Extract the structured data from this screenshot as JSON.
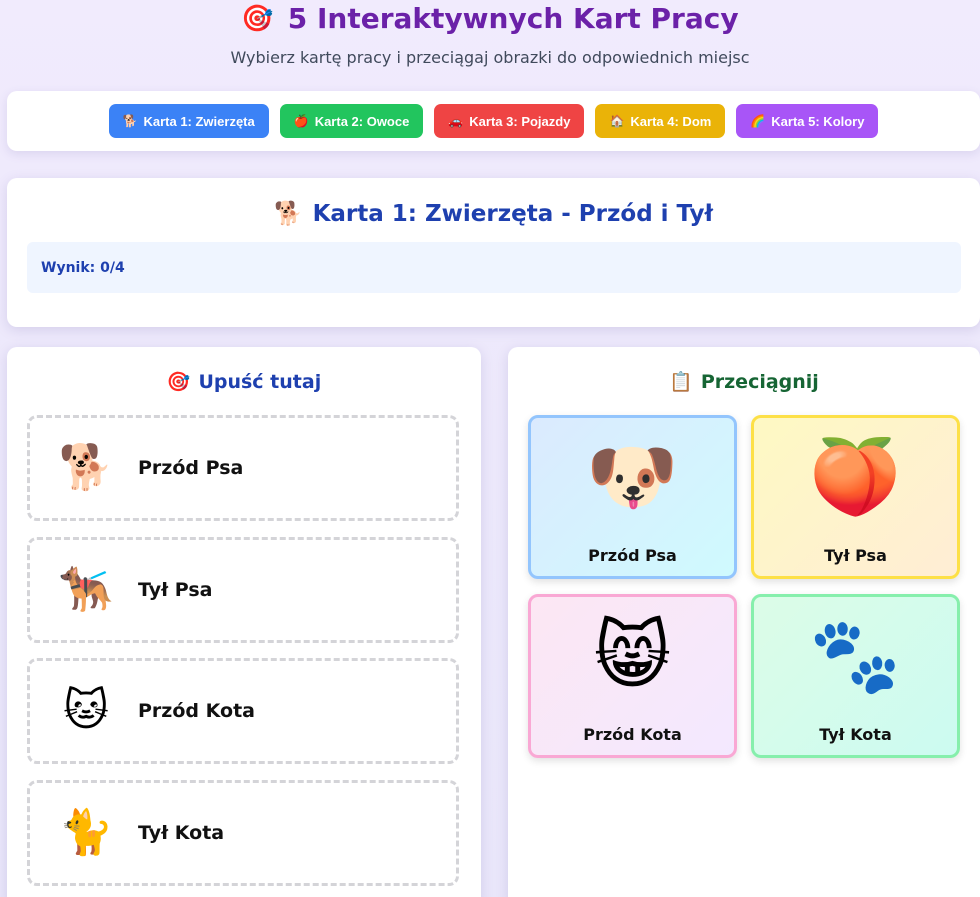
{
  "header": {
    "title_icon": "🎯",
    "title": "5 Interaktywnych Kart Pracy",
    "subtitle": "Wybierz kartę pracy i przeciągaj obrazki do odpowiednich miejsc"
  },
  "tabs": [
    {
      "icon": "🐕",
      "label": "Karta 1: Zwierzęta",
      "color": "#3b82f6"
    },
    {
      "icon": "🍎",
      "label": "Karta 2: Owoce",
      "color": "#22c55e"
    },
    {
      "icon": "🚗",
      "label": "Karta 3: Pojazdy",
      "color": "#ef4444"
    },
    {
      "icon": "🏠",
      "label": "Karta 4: Dom",
      "color": "#eab308"
    },
    {
      "icon": "🌈",
      "label": "Karta 5: Kolory",
      "color": "#a855f7"
    }
  ],
  "card": {
    "icon": "🐕",
    "title": "Karta 1: Zwierzęta - Przód i Tył",
    "score": "Wynik: 0/4"
  },
  "drop_panel": {
    "icon": "🎯",
    "title": "Upuść tutaj",
    "zones": [
      {
        "icon": "🐕",
        "label": "Przód Psa"
      },
      {
        "icon": "🐕‍🦺",
        "label": "Tył Psa"
      },
      {
        "icon": "🐱",
        "label": "Przód Kota"
      },
      {
        "icon": "🐈",
        "label": "Tył Kota"
      }
    ]
  },
  "drag_panel": {
    "icon": "📋",
    "title": "Przeciągnij",
    "tiles": [
      {
        "icon": "🐶",
        "label": "Przód Psa"
      },
      {
        "icon": "🍑",
        "label": "Tył Psa"
      },
      {
        "icon": "😸",
        "label": "Przód Kota"
      },
      {
        "icon": "🐾",
        "label": "Tył Kota"
      }
    ]
  }
}
